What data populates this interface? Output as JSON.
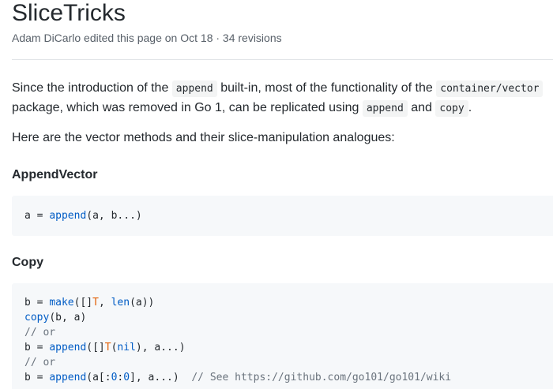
{
  "page": {
    "title": "SliceTricks",
    "meta": "Adam DiCarlo edited this page on Oct 18 · 34 revisions"
  },
  "intro": {
    "t1": "Since the introduction of the ",
    "c1": "append",
    "t2": " built-in, most of the functionality of the ",
    "c2": "container/vector",
    "t3": " package, which was removed in Go 1, can be replicated using ",
    "c3": "append",
    "t4": " and ",
    "c4": "copy",
    "t5": "."
  },
  "intro2": "Here are the vector methods and their slice-manipulation analogues:",
  "sections": {
    "append_vector": {
      "heading": "AppendVector",
      "code": {
        "l1_a": "a = ",
        "l1_fn": "append",
        "l1_rest": "(a, b...)"
      }
    },
    "copy": {
      "heading": "Copy",
      "code": {
        "l1_a": "b = ",
        "l1_fn": "make",
        "l1_b": "([]",
        "l1_t": "T",
        "l1_c": ", ",
        "l1_fn2": "len",
        "l1_d": "(a))",
        "l2_fn": "copy",
        "l2_rest": "(b, a)",
        "l3": "// or",
        "l4_a": "b = ",
        "l4_fn": "append",
        "l4_b": "([]",
        "l4_t": "T",
        "l4_c": "(",
        "l4_nil": "nil",
        "l4_d": "), a...)",
        "l5": "// or",
        "l6_a": "b = ",
        "l6_fn": "append",
        "l6_b": "(a[:",
        "l6_n1": "0",
        "l6_c": ":",
        "l6_n2": "0",
        "l6_d": "], a...)  ",
        "l6_comment": "// See https://github.com/go101/go101/wiki"
      }
    }
  },
  "colors": {
    "text": "#24292e",
    "meta": "#586069",
    "code_bg": "#f6f8fa",
    "keyword": "#005cc5",
    "type": "#e36209",
    "comment": "#6a737d"
  }
}
